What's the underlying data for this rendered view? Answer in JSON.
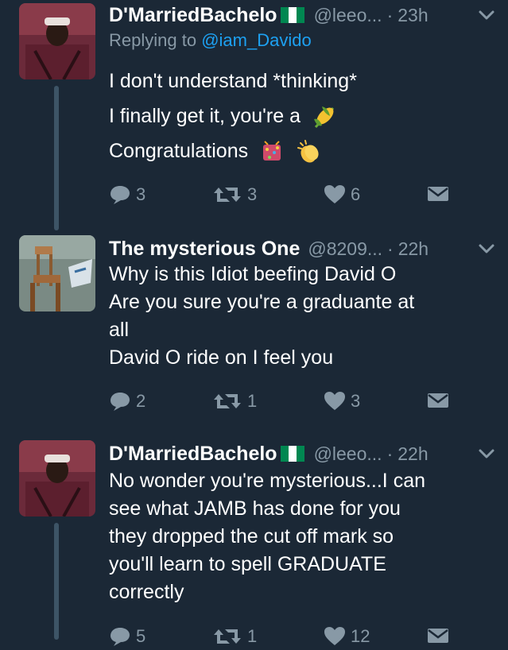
{
  "tweets": [
    {
      "name": "D'MarriedBachelo",
      "handle": "@leeo...",
      "time": "23h",
      "reply_prefix": "Replying to ",
      "reply_handle": "@iam_Davido",
      "lines": [
        "I don't understand *thinking*",
        "I finally get it, you're a",
        "Congratulations"
      ],
      "replies": "3",
      "retweets": "3",
      "likes": "6"
    },
    {
      "name": "The mysterious One",
      "handle": "@8209...",
      "time": "22h",
      "lines": [
        "Why is this Idiot beefing David O",
        "Are you sure you're a graduante at",
        "all",
        "David O ride on I feel you"
      ],
      "replies": "2",
      "retweets": "1",
      "likes": "3"
    },
    {
      "name": "D'MarriedBachelo",
      "handle": "@leeo...",
      "time": "22h",
      "lines": [
        "No wonder you're mysterious...I can",
        "see what JAMB has done for you",
        "they dropped the cut off mark so",
        "you'll learn to spell GRADUATE",
        "correctly"
      ],
      "replies": "5",
      "retweets": "1",
      "likes": "12"
    }
  ],
  "separator": "·",
  "icons": {
    "reply": "reply-icon",
    "retweet": "retweet-icon",
    "like": "heart-icon",
    "dm": "envelope-icon",
    "menu": "chevron-down-icon",
    "flag": "nigeria-flag-icon",
    "corn": "corn-emoji-icon",
    "party": "confetti-emoji-icon",
    "clap": "clapping-hands-emoji-icon"
  },
  "colors": {
    "background": "#1b2836",
    "muted": "#8899a6",
    "link": "#1da1f2",
    "thread": "#3d5466"
  }
}
